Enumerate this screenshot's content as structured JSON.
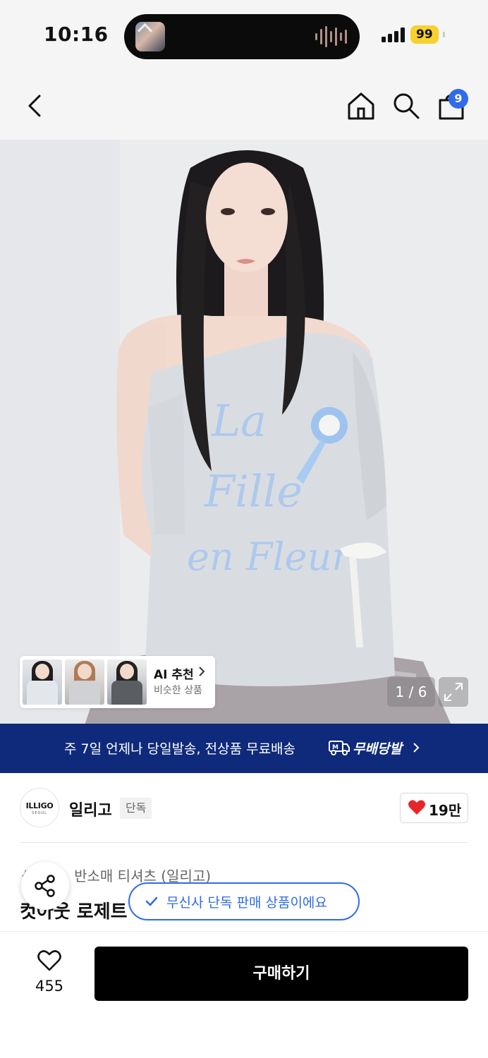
{
  "status_bar": {
    "time": "10:16",
    "battery": "99",
    "battery_color": "#f7d12e"
  },
  "nav": {
    "back_icon": "chevron-left-icon",
    "home_icon": "home-icon",
    "search_icon": "search-icon",
    "bag_icon": "shopping-bag-icon",
    "bag_count": "9",
    "badge_color": "#2f6bea"
  },
  "hero": {
    "print_text": [
      "La",
      "Fille",
      "en Fleur"
    ],
    "page_indicator": "1 / 6",
    "expand_icon": "expand-icon"
  },
  "ai_recommend": {
    "title": "AI 추천",
    "subtitle": "비슷한 상품"
  },
  "banner": {
    "text": "주 7일 언제나 당일발송, 전상품 무료배송",
    "logo_text": "무배당발",
    "background": "#0f2a7a"
  },
  "brand": {
    "logo_text": "ILLIGO",
    "logo_subtext": "SEOUL",
    "name": "일리고",
    "tag": "단독",
    "like_count": "19만",
    "heart_color": "#e8252b"
  },
  "product": {
    "category": "반소매 티셔츠 (일리고)",
    "category_prefix": "상",
    "title": "컷아웃 로제트"
  },
  "floating": {
    "exclusive_notice": "무신사 단독 판매 상품이에요",
    "accent": "#2f6bea"
  },
  "bottom_bar": {
    "wish_count": "455",
    "buy_label": "구매하기"
  }
}
